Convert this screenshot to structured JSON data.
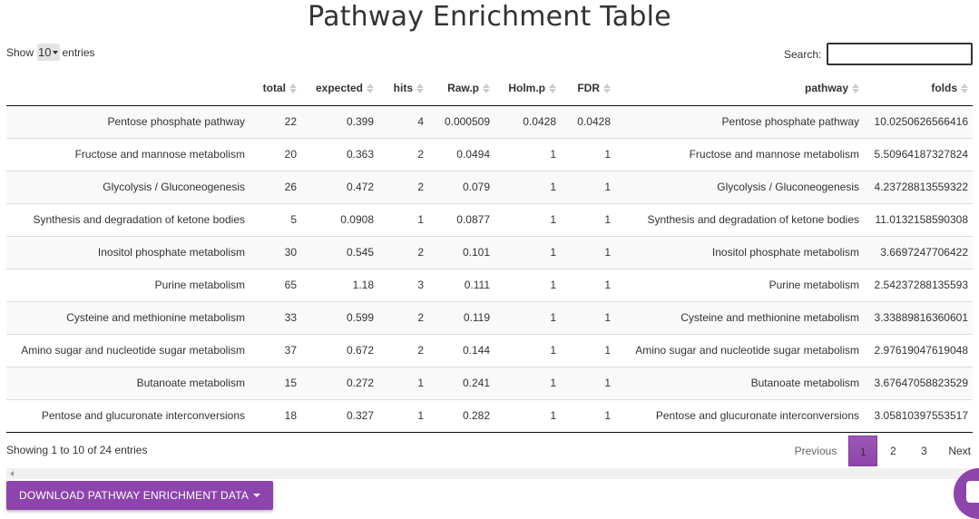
{
  "page": {
    "title": "Pathway Enrichment Table"
  },
  "length": {
    "show_label": "Show",
    "selected": "10",
    "entries_label": "entries"
  },
  "search": {
    "label": "Search:",
    "value": ""
  },
  "table": {
    "columns": [
      "",
      "total",
      "expected",
      "hits",
      "Raw.p",
      "Holm.p",
      "FDR",
      "pathway",
      "folds"
    ],
    "rows": [
      [
        "Pentose phosphate pathway",
        "22",
        "0.399",
        "4",
        "0.000509",
        "0.0428",
        "0.0428",
        "Pentose phosphate pathway",
        "10.0250626566416"
      ],
      [
        "Fructose and mannose metabolism",
        "20",
        "0.363",
        "2",
        "0.0494",
        "1",
        "1",
        "Fructose and mannose metabolism",
        "5.50964187327824"
      ],
      [
        "Glycolysis / Gluconeogenesis",
        "26",
        "0.472",
        "2",
        "0.079",
        "1",
        "1",
        "Glycolysis / Gluconeogenesis",
        "4.23728813559322"
      ],
      [
        "Synthesis and degradation of ketone bodies",
        "5",
        "0.0908",
        "1",
        "0.0877",
        "1",
        "1",
        "Synthesis and degradation of ketone bodies",
        "11.0132158590308"
      ],
      [
        "Inositol phosphate metabolism",
        "30",
        "0.545",
        "2",
        "0.101",
        "1",
        "1",
        "Inositol phosphate metabolism",
        "3.6697247706422"
      ],
      [
        "Purine metabolism",
        "65",
        "1.18",
        "3",
        "0.111",
        "1",
        "1",
        "Purine metabolism",
        "2.54237288135593"
      ],
      [
        "Cysteine and methionine metabolism",
        "33",
        "0.599",
        "2",
        "0.119",
        "1",
        "1",
        "Cysteine and methionine metabolism",
        "3.33889816360601"
      ],
      [
        "Amino sugar and nucleotide sugar metabolism",
        "37",
        "0.672",
        "2",
        "0.144",
        "1",
        "1",
        "Amino sugar and nucleotide sugar metabolism",
        "2.97619047619048"
      ],
      [
        "Butanoate metabolism",
        "15",
        "0.272",
        "1",
        "0.241",
        "1",
        "1",
        "Butanoate metabolism",
        "3.67647058823529"
      ],
      [
        "Pentose and glucuronate interconversions",
        "18",
        "0.327",
        "1",
        "0.282",
        "1",
        "1",
        "Pentose and glucuronate interconversions",
        "3.05810397553517"
      ]
    ]
  },
  "info": {
    "text": "Showing 1 to 10 of 24 entries"
  },
  "pagination": {
    "previous": "Previous",
    "pages": [
      "1",
      "2",
      "3"
    ],
    "current": "1",
    "next": "Next"
  },
  "download": {
    "label": "DOWNLOAD PATHWAY ENRICHMENT DATA"
  },
  "colors": {
    "accent": "#8e44ad",
    "stripe": "#f9f9f9",
    "text": "#333333"
  },
  "icons": {
    "sort": "sort-both-icon",
    "dropdown": "caret-down-icon",
    "chat": "chat-launcher-icon",
    "scroll": "scroll-left-icon"
  }
}
